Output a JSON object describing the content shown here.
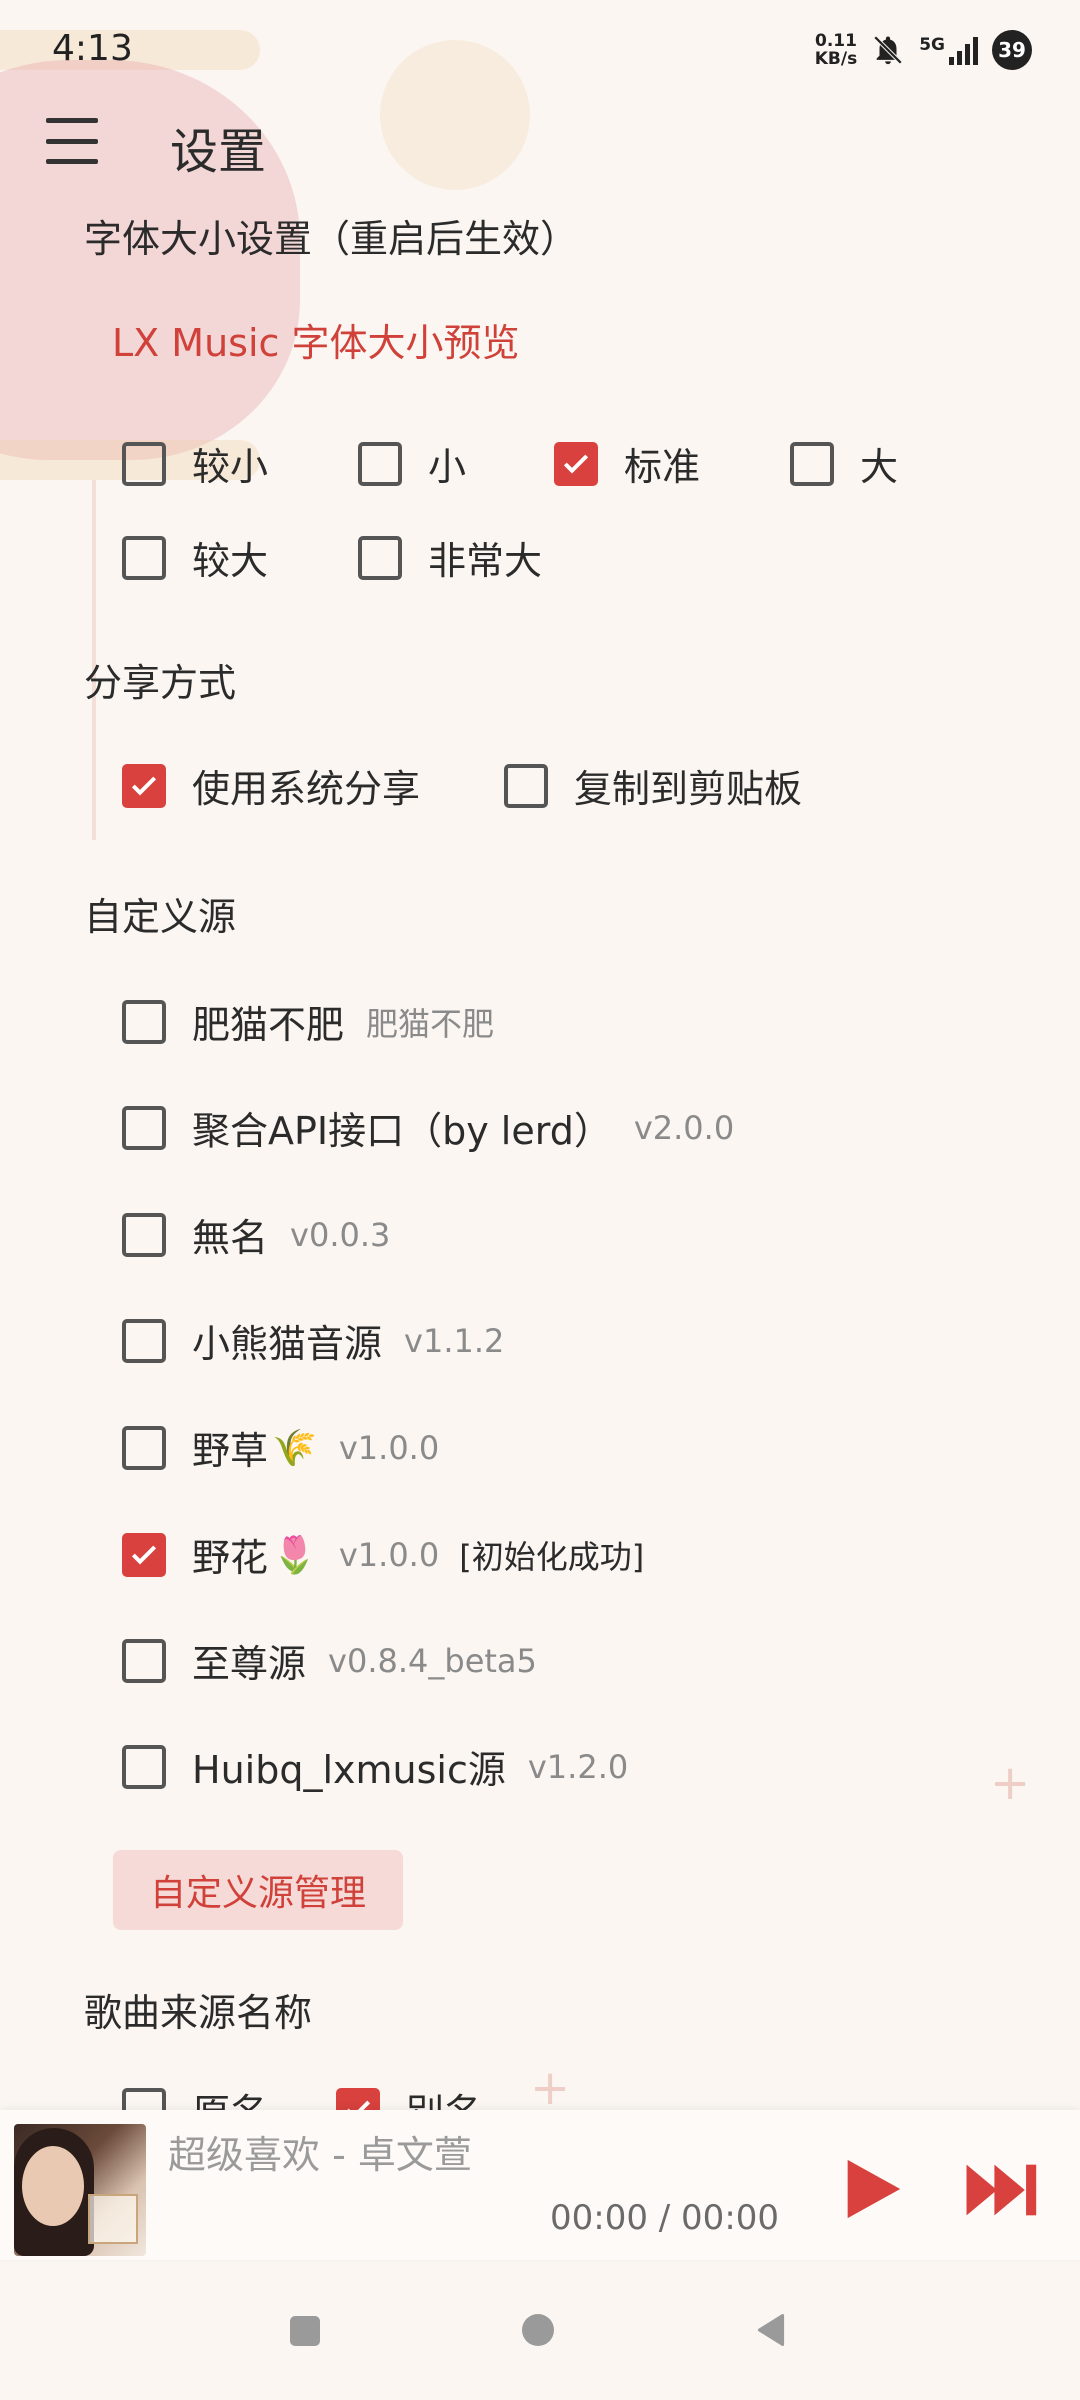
{
  "status_bar": {
    "time": "4:13",
    "net_speed_value": "0.11",
    "net_speed_unit": "KB/s",
    "network_type": "5G",
    "battery": "39"
  },
  "app_bar": {
    "title": "设置"
  },
  "font_size_section": {
    "title": "字体大小设置（重启后生效）",
    "preview": "LX Music 字体大小预览",
    "options": [
      {
        "label": "较小",
        "checked": false
      },
      {
        "label": "小",
        "checked": false
      },
      {
        "label": "标准",
        "checked": true
      },
      {
        "label": "大",
        "checked": false
      },
      {
        "label": "较大",
        "checked": false
      },
      {
        "label": "非常大",
        "checked": false
      }
    ]
  },
  "share_section": {
    "title": "分享方式",
    "options": [
      {
        "label": "使用系统分享",
        "checked": true
      },
      {
        "label": "复制到剪贴板",
        "checked": false
      }
    ]
  },
  "custom_source_section": {
    "title": "自定义源",
    "sources": [
      {
        "name": "肥猫不肥",
        "emoji": "",
        "version": "肥猫不肥",
        "status": "",
        "checked": false
      },
      {
        "name": "聚合API接口（by lerd）",
        "emoji": "",
        "version": "v2.0.0",
        "status": "",
        "checked": false
      },
      {
        "name": "無名",
        "emoji": "",
        "version": "v0.0.3",
        "status": "",
        "checked": false
      },
      {
        "name": "小熊猫音源",
        "emoji": "",
        "version": "v1.1.2",
        "status": "",
        "checked": false
      },
      {
        "name": "野草",
        "emoji": "🌾",
        "version": "v1.0.0",
        "status": "",
        "checked": false
      },
      {
        "name": "野花",
        "emoji": "🌷",
        "version": "v1.0.0",
        "status": "[初始化成功]",
        "checked": true
      },
      {
        "name": "至尊源",
        "emoji": "",
        "version": "v0.8.4_beta5",
        "status": "",
        "checked": false
      },
      {
        "name": "Huibq_lxmusic源",
        "emoji": "",
        "version": "v1.2.0",
        "status": "",
        "checked": false
      }
    ],
    "manage_button": "自定义源管理"
  },
  "song_source_name_section": {
    "title": "歌曲来源名称",
    "options": [
      {
        "label": "原名",
        "checked": false
      },
      {
        "label": "别名",
        "checked": true
      }
    ]
  },
  "player": {
    "song_title": "超级喜欢 - 卓文萱",
    "time": "00:00 / 00:00"
  },
  "colors": {
    "accent": "#d8413d",
    "background": "#fbf6f2"
  }
}
